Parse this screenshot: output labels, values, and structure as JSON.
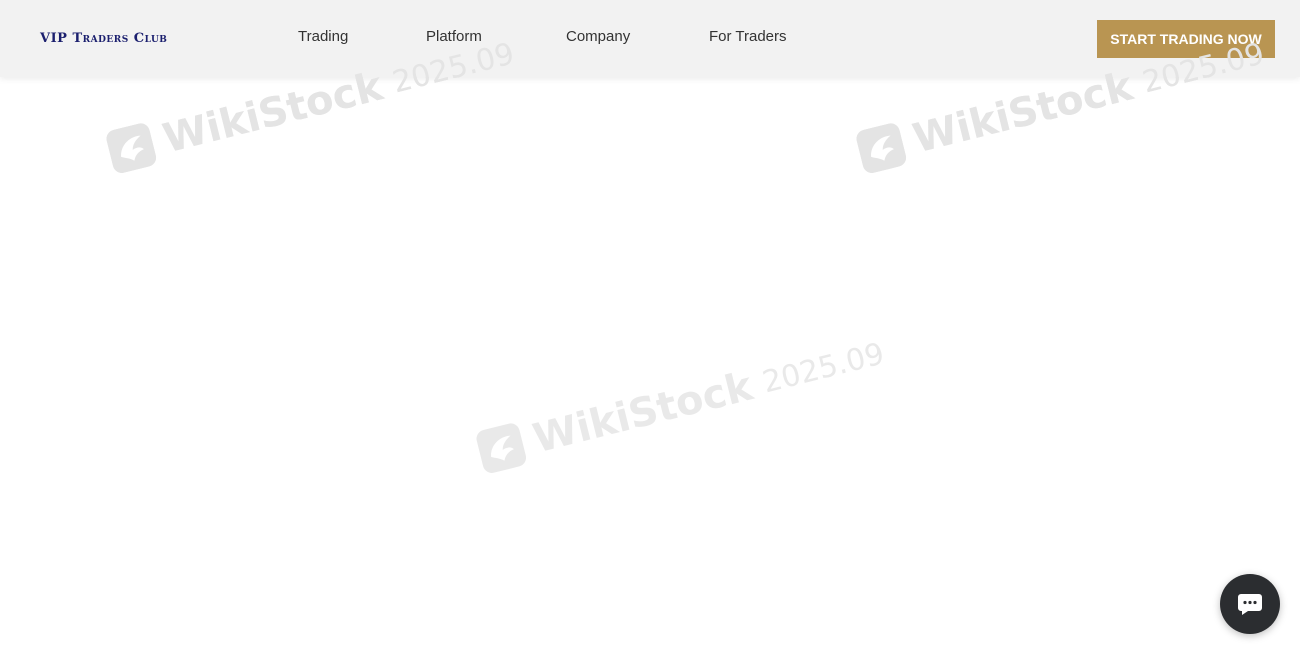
{
  "header": {
    "logo_text": "VIP Traders Club",
    "nav": {
      "trading": "Trading",
      "platform": "Platform",
      "company": "Company",
      "for_traders": "For Traders"
    },
    "cta_label": "START TRADING NOW"
  },
  "watermark": {
    "brand": "WikiStock",
    "date": "2025.09",
    "icon": "wikistock-logo-icon"
  },
  "chat": {
    "icon": "chat-bubble-icon"
  },
  "colors": {
    "header_bg": "#f2f2f2",
    "cta_bg": "#b99552",
    "logo_text": "#1b1f6e",
    "chat_bg": "#2b2d30"
  }
}
